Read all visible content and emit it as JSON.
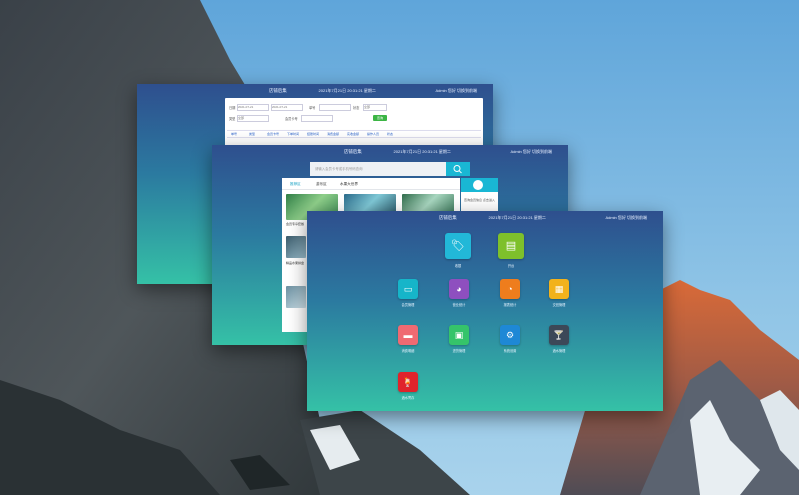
{
  "colors": {
    "window_top": "#2e4f8e",
    "window_bottom": "#35c1a6",
    "accent": "#19b7d4",
    "green_button": "#3cb545"
  },
  "window1": {
    "title": "店铺后集",
    "date": "2021年7月21日 20:31:21 星期二",
    "user": "Admin 您好  切换到前端",
    "form": {
      "label1": "日期",
      "label2": "类型",
      "label3": "单号",
      "label4": "状态",
      "label5": "会员卡号",
      "input1": "2021-07-21",
      "input2": "2021-07-21",
      "select1": "全部",
      "select2": "全部",
      "button": "查询",
      "tabs": [
        "单号",
        "类型",
        "会员卡号",
        "下单时间",
        "结账时间",
        "消费金额",
        "实收金额",
        "操作人员",
        "状态"
      ]
    }
  },
  "window2": {
    "title": "店铺后集",
    "date": "2021年7月21日 20:31:21 星期二",
    "user": "Admin 您好  切换到前端",
    "search_placeholder": "请输入会员卡号或手机号码查询",
    "tabs": [
      "推荐区",
      "游乐区",
      "水果大世界"
    ],
    "items": [
      "会员专享套餐",
      "精品水果拼盘"
    ],
    "sidecard_text": "查询会员信息 点击进入",
    "icons": {
      "search": "search-icon"
    }
  },
  "window3": {
    "title": "店铺后集",
    "date": "2021年7月21日 20:31:21 星期二",
    "user": "Admin 您好  切换到前端",
    "apps": [
      {
        "label": "收银",
        "icon": "tag-icon"
      },
      {
        "label": "开台",
        "icon": "cash-register-icon"
      },
      {
        "label": "会员管理",
        "icon": "card-icon"
      },
      {
        "label": "营业统计",
        "icon": "pie-chart-icon"
      },
      {
        "label": "报表统计",
        "icon": "pie-chart-alt-icon"
      },
      {
        "label": "交班管理",
        "icon": "document-settings-icon"
      },
      {
        "label": "消费明细",
        "icon": "receipt-icon"
      },
      {
        "label": "进货管理",
        "icon": "document-gear-icon"
      },
      {
        "label": "系统设置",
        "icon": "gear-icon"
      },
      {
        "label": "酒水管理",
        "icon": "cocktail-icon"
      },
      {
        "label": "酒水寄存",
        "icon": "cocktail-red-icon"
      }
    ]
  }
}
